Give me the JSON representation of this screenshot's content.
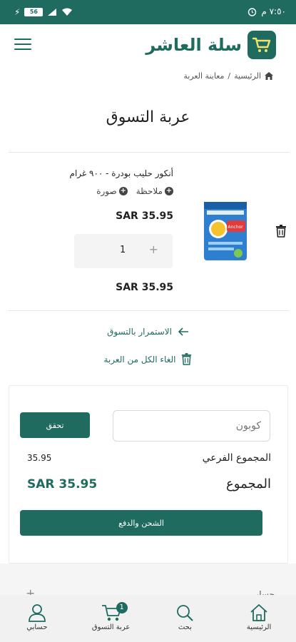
{
  "status_bar": {
    "time": "٧:٥٠ م",
    "battery": "56"
  },
  "header": {
    "brand_name": "سلة العاشر"
  },
  "breadcrumb": {
    "home": "الرئيسية",
    "separator": "/",
    "current": "معاينة العربة"
  },
  "page": {
    "title": "عربة التسوق"
  },
  "cart_item": {
    "name": "أنكور حليب بودرة - ٩٠٠ غرام",
    "note_label": "ملاحظة",
    "image_label": "صورة",
    "unit_price": "SAR 35.95",
    "quantity": "1",
    "qty_plus": "+",
    "total_price": "SAR 35.95",
    "product_brand": "Anchor"
  },
  "links": {
    "continue_shopping": "الاستمرار بالتسوق",
    "clear_cart": "الغاء الكل من العربة"
  },
  "summary": {
    "coupon_placeholder": "كوبون",
    "check_button": "تحقق",
    "subtotal_label": "المجموع الفرعي",
    "subtotal_value": "35.95",
    "total_label": "المجموع",
    "total_value": "SAR 35.95",
    "checkout_button": "الشحن والدفع"
  },
  "ghost_row": {
    "label": "حسابي",
    "symbol": "+"
  },
  "bottom_nav": {
    "home": "الرئيسية",
    "search": "بحث",
    "cart": "عربة التسوق",
    "cart_badge": "1",
    "account": "حسابي"
  },
  "colors": {
    "primary": "#1f6b5f",
    "status_bar": "#1f6b5f",
    "nav_bg": "#f1f1f1"
  }
}
